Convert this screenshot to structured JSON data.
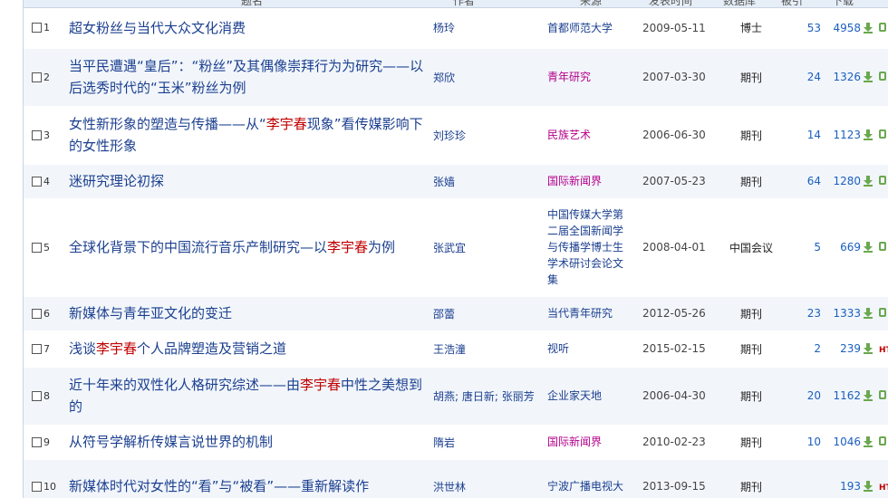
{
  "header": {
    "col_title": "题名",
    "col_author": "作者",
    "col_source": "来源",
    "col_date": "发表时间",
    "col_db": "数据库",
    "col_cite": "被引",
    "col_download": "下载"
  },
  "rows": [
    {
      "num": "1",
      "title": [
        {
          "t": "超女粉丝与当代大众文化消费"
        }
      ],
      "author": "杨玲",
      "source": [
        "首都师范大学"
      ],
      "source_mag": false,
      "date": "2009-05-11",
      "type": "博士",
      "cite": "53",
      "downloads": "4958",
      "extra": "read"
    },
    {
      "num": "2",
      "title": [
        {
          "t": "当平民遭遇“皇后”：“粉丝”及其偶像崇拜行为为研究——以后选秀时代的“玉米”粉丝为例"
        }
      ],
      "author": "郑欣",
      "source": [
        "青年研究"
      ],
      "source_mag": true,
      "date": "2007-03-30",
      "type": "期刊",
      "cite": "24",
      "downloads": "1326",
      "extra": "read"
    },
    {
      "num": "3",
      "title": [
        {
          "t": "女性新形象的塑造与传播——从“"
        },
        {
          "t": "李宇春",
          "hl": true
        },
        {
          "t": "现象”看传媒影响下的女性形象"
        }
      ],
      "author": "刘珍珍",
      "source": [
        "民族艺术"
      ],
      "source_mag": true,
      "date": "2006-06-30",
      "type": "期刊",
      "cite": "14",
      "downloads": "1123",
      "extra": "read"
    },
    {
      "num": "4",
      "title": [
        {
          "t": "迷研究理论初探"
        }
      ],
      "author": "张嫱",
      "source": [
        "国际新闻界"
      ],
      "source_mag": true,
      "date": "2007-05-23",
      "type": "期刊",
      "cite": "64",
      "downloads": "1280",
      "extra": "read"
    },
    {
      "num": "5",
      "title": [
        {
          "t": "全球化背景下的中国流行音乐产制研究—以"
        },
        {
          "t": "李宇春",
          "hl": true
        },
        {
          "t": "为例"
        }
      ],
      "author": "张武宜",
      "source": [
        "中国传媒大学第",
        "二届全国新闻学",
        "与传播学博士生",
        "学术研讨会论文",
        "集"
      ],
      "source_mag": false,
      "date": "2008-04-01",
      "type": "中国会议",
      "cite": "5",
      "downloads": "669",
      "extra": "read"
    },
    {
      "num": "6",
      "title": [
        {
          "t": "新媒体与青年亚文化的变迁"
        }
      ],
      "author": "邵蕾",
      "source": [
        "当代青年研究"
      ],
      "source_mag": false,
      "date": "2012-05-26",
      "type": "期刊",
      "cite": "23",
      "downloads": "1333",
      "extra": "read"
    },
    {
      "num": "7",
      "title": [
        {
          "t": "浅谈"
        },
        {
          "t": "李宇春",
          "hl": true
        },
        {
          "t": "个人品牌塑造及营销之道"
        }
      ],
      "author": "王浩潼",
      "source": [
        "视听"
      ],
      "source_mag": false,
      "date": "2015-02-15",
      "type": "期刊",
      "cite": "2",
      "downloads": "239",
      "extra": "HT"
    },
    {
      "num": "8",
      "title": [
        {
          "t": "近十年来的双性化人格研究综述——由"
        },
        {
          "t": "李宇春",
          "hl": true
        },
        {
          "t": "中性之美想到的"
        }
      ],
      "author": "胡燕; 唐日新; 张丽芳",
      "source": [
        "企业家天地"
      ],
      "source_mag": false,
      "date": "2006-04-30",
      "type": "期刊",
      "cite": "20",
      "downloads": "1162",
      "extra": "read"
    },
    {
      "num": "9",
      "title": [
        {
          "t": "从符号学解析传媒言说世界的机制"
        }
      ],
      "author": "隋岩",
      "source": [
        "国际新闻界"
      ],
      "source_mag": true,
      "date": "2010-02-23",
      "type": "期刊",
      "cite": "10",
      "downloads": "1046",
      "extra": "read"
    },
    {
      "num": "10",
      "title": [
        {
          "t": "新媒体时代对女性的“看”与“被看”——重新解读作"
        }
      ],
      "author": "洪世林",
      "source": [
        "宁波广播电视大"
      ],
      "source_mag": false,
      "date": "2013-09-15",
      "type": "期刊",
      "cite": "",
      "downloads": "193",
      "extra": "HT"
    }
  ],
  "icons": {
    "download": "download-icon",
    "read": "read-icon",
    "html": "html-icon"
  },
  "colors": {
    "title_link": "#1b3f8f",
    "highlight": "#c00000",
    "magazine_source": "#b4008a",
    "row_alt": "#f2f6fb",
    "download_icon": "#6aa84f"
  }
}
